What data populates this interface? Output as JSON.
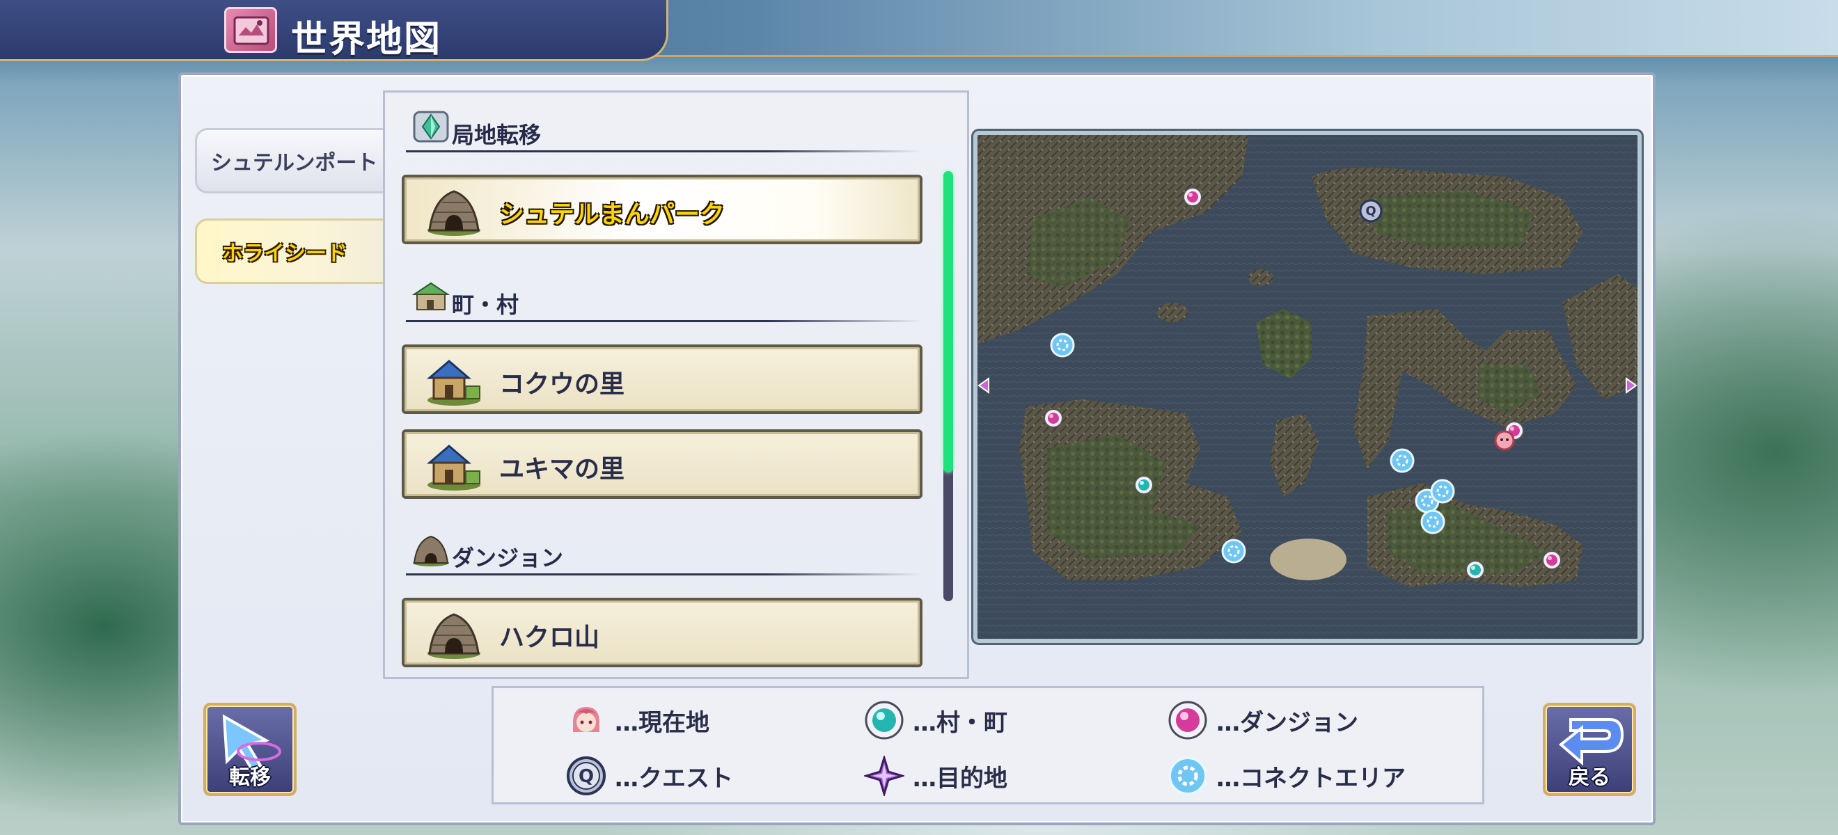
{
  "header": {
    "title": "世界地図"
  },
  "regions": [
    {
      "label": "シュテルンポート",
      "selected": false
    },
    {
      "label": "ホライシード",
      "selected": true
    }
  ],
  "sections": [
    {
      "label": "局地転移",
      "icon": "teleport-crystal-icon"
    },
    {
      "label": "町・村",
      "icon": "village-icon"
    },
    {
      "label": "ダンジョン",
      "icon": "cave-icon"
    }
  ],
  "list": {
    "items": [
      {
        "label": "シュテルまんパーク",
        "section": "局地転移",
        "icon": "cave-icon",
        "selected": true
      },
      {
        "label": "コクウの里",
        "section": "町・村",
        "icon": "house-icon",
        "selected": false
      },
      {
        "label": "ユキマの里",
        "section": "町・村",
        "icon": "house-icon",
        "selected": false
      },
      {
        "label": "ハクロ山",
        "section": "ダンジョン",
        "icon": "cave-icon",
        "selected": false
      }
    ],
    "scroll_fraction": 0.7
  },
  "legend": {
    "current": "…現在地",
    "village": "…村・町",
    "dungeon": "…ダンジョン",
    "quest": "…クエスト",
    "destination": "…目的地",
    "connect": "…コネクトエリア"
  },
  "buttons": {
    "teleport": "転移",
    "back": "戻る"
  },
  "colors": {
    "accent_gold": "#d3ad62",
    "dungeon_marker": "#d43b9b",
    "village_marker": "#25b5b0",
    "connect_marker": "#6fc6f3",
    "scroll_thumb": "#20e27c",
    "panel_navy": "#2c3a6c"
  }
}
